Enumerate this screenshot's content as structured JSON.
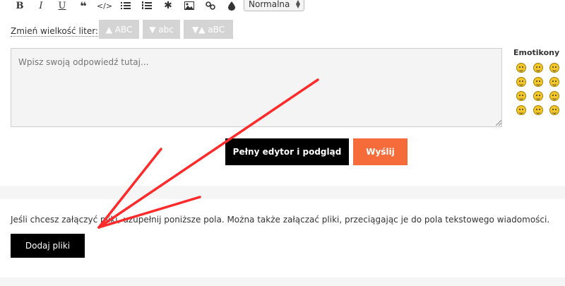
{
  "toolbar": {
    "buttons": [
      {
        "name": "bold-button",
        "glyph": "B"
      },
      {
        "name": "italic-button",
        "glyph": "I"
      },
      {
        "name": "underline-button",
        "glyph": "U"
      },
      {
        "name": "quote-button",
        "glyph": "❝"
      },
      {
        "name": "code-button",
        "glyph": "</>"
      },
      {
        "name": "bullet-list-button",
        "icon": "bullet-list-icon"
      },
      {
        "name": "numbered-list-button",
        "icon": "numbered-list-icon"
      },
      {
        "name": "asterisk-button",
        "glyph": "✱"
      },
      {
        "name": "image-button",
        "icon": "image-icon"
      },
      {
        "name": "link-button",
        "icon": "link-icon"
      },
      {
        "name": "color-button",
        "icon": "drop-icon"
      }
    ],
    "font_size_select": "Normalna"
  },
  "case_change": {
    "label": "Zmień wielkość liter:",
    "upper": "▲ ABC",
    "lower": "▼ abc",
    "toggle": "▼▲ aBC"
  },
  "reply": {
    "placeholder": "Wpisz swoją odpowiedź tutaj..."
  },
  "emoticons": {
    "title": "Emotikony",
    "count": 12
  },
  "actions": {
    "full_editor": "Pełny edytor i podgląd",
    "send": "Wyślij"
  },
  "attachments": {
    "info": "Jeśli chcesz załączyć pliki, uzupełnij poniższe pola. Można także załączać pliki, przeciągając je do pola tekstowego wiadomości.",
    "add_button": "Dodaj pliki"
  },
  "colors": {
    "accent_orange": "#f56b3a",
    "arrow_red": "#ff2a2a",
    "button_dark": "#000000",
    "case_button": "#d4d4d4"
  }
}
